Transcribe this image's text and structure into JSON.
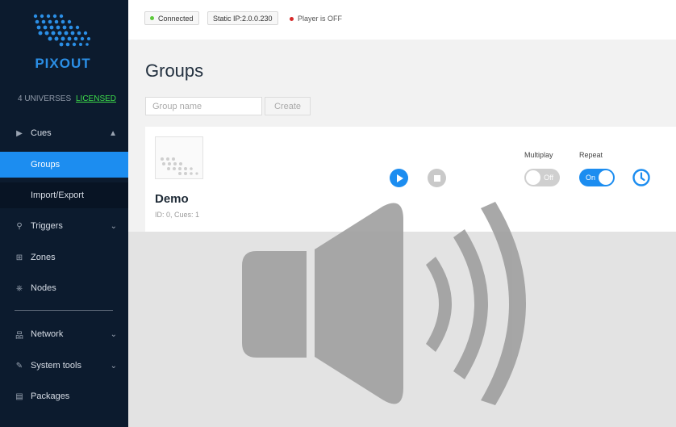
{
  "brand": {
    "logo_text": "PIXOUT"
  },
  "license": {
    "universes": "4 UNIVERSES",
    "status": "LICENSED"
  },
  "sidebar": {
    "items": [
      {
        "label": "Cues",
        "icon": "caret-right-icon",
        "chevron": "▲"
      },
      {
        "label": "Groups"
      },
      {
        "label": "Import/Export"
      },
      {
        "label": "Triggers",
        "icon": "link-icon",
        "chevron": "⌄"
      },
      {
        "label": "Zones",
        "icon": "grid-icon"
      },
      {
        "label": "Nodes",
        "icon": "node-icon"
      },
      {
        "label": "Network",
        "icon": "network-icon",
        "chevron": "⌄"
      },
      {
        "label": "System tools",
        "icon": "wrench-icon",
        "chevron": "⌄"
      },
      {
        "label": "Packages",
        "icon": "package-icon"
      }
    ]
  },
  "status": {
    "connected": "Connected",
    "static_ip": "Static IP:2.0.0.230",
    "player": "Player is OFF",
    "colors": {
      "connected": "#5cc93a",
      "player_off": "#d62a2a"
    }
  },
  "main": {
    "title": "Groups",
    "group_name_placeholder": "Group name",
    "create_label": "Create",
    "groups": [
      {
        "name": "Demo",
        "meta": "ID: 0, Cues: 1",
        "multiplay_label": "Multiplay",
        "multiplay_state": "Off",
        "repeat_label": "Repeat",
        "repeat_state": "On"
      }
    ]
  },
  "overlay": {
    "icon": "speaker-volume-icon"
  },
  "accent_color": "#1c8df0"
}
